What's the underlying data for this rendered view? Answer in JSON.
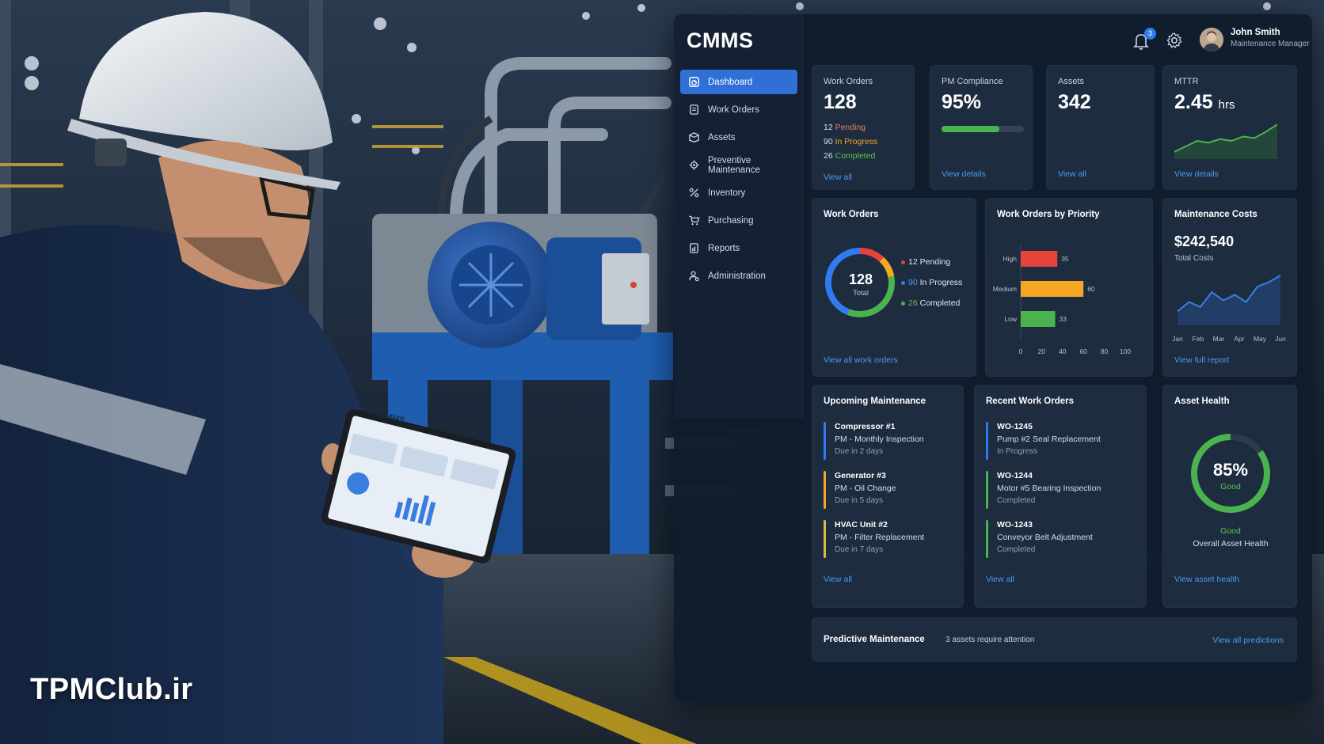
{
  "watermark": "TPMClub.ir",
  "tablet": {
    "title": "CMMS"
  },
  "app": {
    "title": "CMMS"
  },
  "sidebar": {
    "items": [
      {
        "label": "Dashboard",
        "icon": "dashboard-icon",
        "active": true
      },
      {
        "label": "Work Orders",
        "icon": "clipboard-icon",
        "active": false
      },
      {
        "label": "Assets",
        "icon": "box-icon",
        "active": false
      },
      {
        "label": "Preventive Maintenance",
        "icon": "wrench-gear-icon",
        "active": false
      },
      {
        "label": "Inventory",
        "icon": "inventory-icon",
        "active": false
      },
      {
        "label": "Purchasing",
        "icon": "cart-icon",
        "active": false
      },
      {
        "label": "Reports",
        "icon": "report-icon",
        "active": false
      },
      {
        "label": "Administration",
        "icon": "admin-icon",
        "active": false
      }
    ]
  },
  "header": {
    "notifications": "3",
    "user_name": "John Smith",
    "user_role": "Maintenance Manager"
  },
  "kpis": {
    "work_orders": {
      "label": "Work Orders",
      "value": "128",
      "pending_n": "12",
      "pending": "Pending",
      "inprog_n": "90",
      "inprog": "In Progress",
      "done_n": "26",
      "done": "Completed",
      "link": "View all"
    },
    "pm_compliance": {
      "label": "PM Compliance",
      "value": "95%",
      "percent": 0.7,
      "link": "View details"
    },
    "assets": {
      "label": "Assets",
      "value": "342",
      "link": "View all"
    },
    "mttr": {
      "label": "MTTR",
      "value": "2.45",
      "unit": "hrs",
      "link": "View details"
    }
  },
  "work_orders_chart": {
    "title": "Work Orders",
    "total": "128",
    "total_label": "Total",
    "legend": [
      {
        "n": "12",
        "label": "Pending",
        "color": "#e8433a"
      },
      {
        "n": "90",
        "label": "In Progress",
        "color": "#2f7bf0"
      },
      {
        "n": "26",
        "label": "Completed",
        "color": "#4ab34e"
      }
    ],
    "link": "View all work orders"
  },
  "priority_chart": {
    "title": "Work Orders by Priority",
    "link": ""
  },
  "costs": {
    "title": "Maintenance Costs",
    "value": "$242,540",
    "sub": "Total Costs",
    "link": "View full report"
  },
  "upcoming": {
    "title": "Upcoming Maintenance",
    "items": [
      {
        "name": "Compressor #1",
        "task": "PM - Monthly Inspection",
        "due": "Due in 2 days",
        "color": "#2f7bf0"
      },
      {
        "name": "Generator #3",
        "task": "PM - Oil Change",
        "due": "Due in 5 days",
        "color": "#f6a623"
      },
      {
        "name": "HVAC Unit #2",
        "task": "PM - Filter Replacement",
        "due": "Due in 7 days",
        "color": "#e0b93a"
      }
    ],
    "link": "View all"
  },
  "recent": {
    "title": "Recent Work Orders",
    "items": [
      {
        "id": "WO-1245",
        "desc": "Pump #2 Seal Replacement",
        "status": "In Progress",
        "color": "#2f7bf0"
      },
      {
        "id": "WO-1244",
        "desc": "Motor #5 Bearing Inspection",
        "status": "Completed",
        "color": "#4ab34e"
      },
      {
        "id": "WO-1243",
        "desc": "Conveyor Belt Adjustment",
        "status": "Completed",
        "color": "#4ab34e"
      }
    ],
    "link": "View all"
  },
  "asset_health": {
    "title": "Asset Health",
    "value": "85%",
    "status": "Good",
    "status2": "Good",
    "caption": "Overall Asset Health",
    "link": "View asset health"
  },
  "predictive": {
    "title": "Predictive Maintenance",
    "message": "3 assets require attention",
    "link": "View all predictions"
  },
  "chart_data": [
    {
      "type": "pie",
      "title": "Work Orders",
      "categories": [
        "Pending",
        "In Progress",
        "Completed"
      ],
      "values": [
        12,
        90,
        26
      ],
      "colors": [
        "#e8433a",
        "#f6a623",
        "#4ab34e"
      ]
    },
    {
      "type": "bar",
      "title": "Work Orders by Priority",
      "orientation": "horizontal",
      "categories": [
        "High",
        "Medium",
        "Low"
      ],
      "values": [
        35,
        60,
        33
      ],
      "colors": [
        "#e8433a",
        "#f6a623",
        "#4ab34e"
      ],
      "xlim": [
        0,
        100
      ],
      "xticks": [
        "0",
        "20",
        "40",
        "60",
        "80",
        "100"
      ]
    },
    {
      "type": "line",
      "title": "Maintenance Costs",
      "x": [
        "Jan",
        "Feb",
        "Mar",
        "Apr",
        "May",
        "Jun"
      ],
      "values": [
        0.25,
        0.42,
        0.33,
        0.6,
        0.45,
        0.55,
        0.42,
        0.7,
        0.78,
        0.9
      ],
      "color": "#3a7fe6"
    },
    {
      "type": "line",
      "title": "MTTR",
      "values": [
        0.2,
        0.35,
        0.5,
        0.45,
        0.55,
        0.5,
        0.62,
        0.58,
        0.75,
        0.95
      ],
      "color": "#4ab34e"
    },
    {
      "type": "pie",
      "title": "Asset Health",
      "values": [
        85,
        15
      ],
      "colors": [
        "#4ab34e",
        "#2d3b4d"
      ]
    }
  ]
}
